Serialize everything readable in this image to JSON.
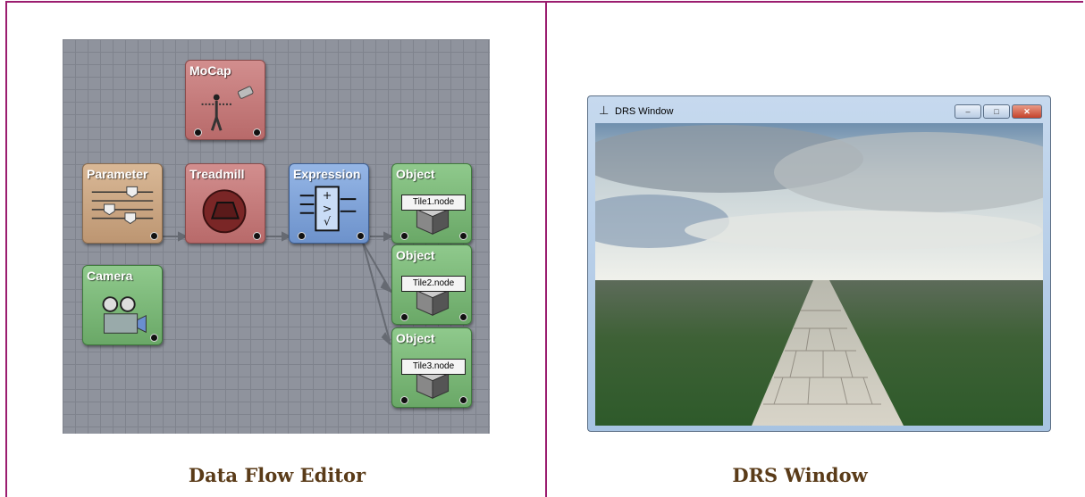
{
  "captions": {
    "left": "Data Flow Editor",
    "right": "DRS Window"
  },
  "nodes": {
    "mocap": {
      "title": "MoCap"
    },
    "parameter": {
      "title": "Parameter"
    },
    "treadmill": {
      "title": "Treadmill"
    },
    "expression": {
      "title": "Expression"
    },
    "camera": {
      "title": "Camera"
    },
    "object1": {
      "title": "Object",
      "tag": "Tile1.node"
    },
    "object2": {
      "title": "Object",
      "tag": "Tile2.node"
    },
    "object3": {
      "title": "Object",
      "tag": "Tile3.node"
    }
  },
  "window": {
    "title": "DRS Window",
    "icon": "figure-icon",
    "buttons": {
      "minimize": "–",
      "maximize": "□",
      "close": "✕"
    }
  },
  "colors": {
    "border": "#9b1d6f",
    "caption": "#5a3b18",
    "red_node": "#c97a7a",
    "tan_node": "#c9a27f",
    "blue_node": "#7a9fd6",
    "green_node": "#7fb77a"
  }
}
